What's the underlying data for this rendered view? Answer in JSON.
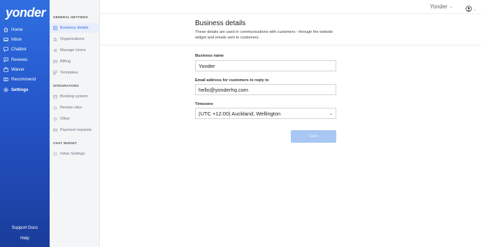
{
  "brand": {
    "logo_text": "yonder"
  },
  "nav": {
    "items": [
      {
        "label": "Home",
        "icon": "home-icon"
      },
      {
        "label": "Inbox",
        "icon": "inbox-icon"
      },
      {
        "label": "Chatbot",
        "icon": "chat-icon"
      },
      {
        "label": "Reviews",
        "icon": "reviews-icon"
      },
      {
        "label": "Waiver",
        "icon": "waiver-icon"
      },
      {
        "label": "Recommend",
        "icon": "recommend-icon"
      },
      {
        "label": "Settings",
        "icon": "gear-icon",
        "active": true
      }
    ],
    "support_docs": "Support Docs",
    "help": "Help"
  },
  "settings_sidebar": {
    "general_title": "GENERAL SETTINGS",
    "general_items": [
      {
        "label": "Business details",
        "active": true
      },
      {
        "label": "Organizations"
      },
      {
        "label": "Manage Users"
      },
      {
        "label": "Billing"
      },
      {
        "label": "Templates"
      }
    ],
    "integrations_title": "INTEGRATIONS",
    "integration_items": [
      {
        "label": "Booking system"
      },
      {
        "label": "Review sites"
      },
      {
        "label": "Other"
      },
      {
        "label": "Payment requests"
      }
    ],
    "chat_title": "CHAT WIDGET",
    "chat_items": [
      {
        "label": "Inbox Settings"
      }
    ]
  },
  "topbar": {
    "account_name": "Yonder"
  },
  "main": {
    "title": "Business details",
    "description": "These details are used in communications with customers - through the website widget and emails sent to customers.",
    "business_name_label": "Business name",
    "business_name_value": "Yonder",
    "email_label": "Email address for customers to reply to",
    "email_value": "hello@yonderhq.com",
    "timezone_label": "Timezone",
    "timezone_value": "(UTC +12:00) Auckland, Wellington",
    "save_label": "Save"
  },
  "colors": {
    "nav_gradient_top": "#2f6fe0",
    "nav_gradient_bottom": "#1a3c9a",
    "active_link": "#3b6fe0",
    "save_button": "#a8c7f2"
  }
}
